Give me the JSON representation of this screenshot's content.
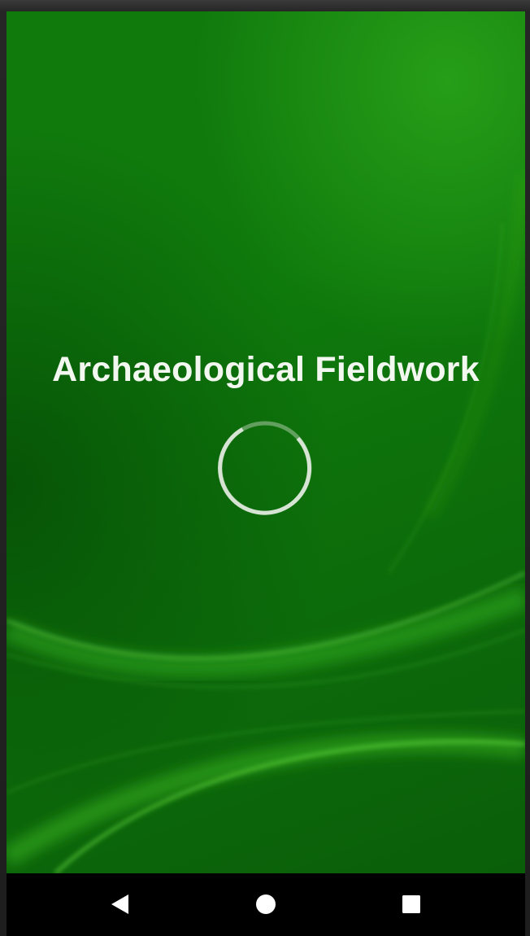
{
  "app": {
    "title": "Archaeological Fieldwork"
  },
  "loading": {
    "indicator": "spinner-icon"
  },
  "navigation": {
    "buttons": [
      {
        "name": "back-button",
        "icon": "triangle-back-icon"
      },
      {
        "name": "home-button",
        "icon": "circle-home-icon"
      },
      {
        "name": "recents-button",
        "icon": "square-recents-icon"
      }
    ]
  },
  "colors": {
    "background_green": "#0f7a0c",
    "highlight_green": "#2eaa1c",
    "title_text": "#f2f7f0",
    "nav_bar": "#000000",
    "nav_icons": "#ffffff"
  }
}
